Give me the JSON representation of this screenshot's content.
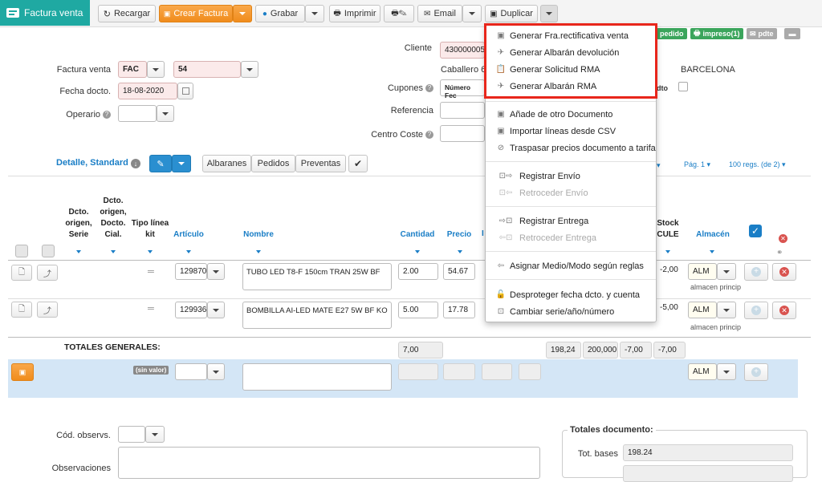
{
  "app": {
    "title": "Factura venta"
  },
  "toolbar": {
    "reload": "Recargar",
    "create_invoice": "Crear Factura",
    "save": "Grabar",
    "print": "Imprimir",
    "email": "Email",
    "duplicate": "Duplicar"
  },
  "badges": {
    "pedido": "pedido",
    "impreso": "impreso(1)",
    "pdte": "pdte"
  },
  "form": {
    "factura_label": "Factura venta",
    "serie": "FAC",
    "numero": "54",
    "fecha_label": "Fecha docto.",
    "fecha": "18-08-2020",
    "operario_label": "Operario",
    "cliente_label": "Cliente",
    "cliente_code": "430000005",
    "cliente_name": "Caballero 67",
    "ciudad": "BARCELONA",
    "cupones_label": "Cupones",
    "cupones_col1": "Número",
    "cupones_col2": "Fec",
    "dto_label": "dto",
    "referencia_label": "Referencia",
    "centro_coste_label": "Centro Coste"
  },
  "menu": {
    "items": [
      {
        "label": "Generar Fra.rectificativa venta",
        "icon": "doc-star-icon",
        "disabled": false
      },
      {
        "label": "Generar Albarán devolución",
        "icon": "plane-icon",
        "disabled": false
      },
      {
        "label": "Generar Solicitud RMA",
        "icon": "clipboard-icon",
        "disabled": false
      },
      {
        "label": "Generar Albarán RMA",
        "icon": "plane-icon",
        "disabled": false
      },
      {
        "label": "Añade de otro Documento",
        "icon": "doc-star-icon",
        "disabled": false
      },
      {
        "label": "Importar líneas desde CSV",
        "icon": "doc-star-icon",
        "disabled": false
      },
      {
        "label": "Traspasar precios documento a tarifa",
        "icon": "tag-icon",
        "disabled": false
      },
      {
        "label": "Registrar Envío",
        "icon": "box-arrow-icon",
        "disabled": false
      },
      {
        "label": "Retroceder Envío",
        "icon": "box-arrow-icon",
        "disabled": true
      },
      {
        "label": "Registrar Entrega",
        "icon": "truck-arrow-icon",
        "disabled": false
      },
      {
        "label": "Retroceder Entrega",
        "icon": "truck-arrow-icon",
        "disabled": true
      },
      {
        "label": "Asignar Medio/Modo según reglas",
        "icon": "arrow-left-icon",
        "disabled": false
      },
      {
        "label": "Desproteger fecha dcto. y cuenta",
        "icon": "lock-icon",
        "disabled": false
      },
      {
        "label": "Cambiar serie/año/número",
        "icon": "box-icon",
        "disabled": false
      }
    ]
  },
  "detail": {
    "view_label": "Detalle, Standard",
    "tabs": [
      "Albaranes",
      "Pedidos",
      "Preventas"
    ],
    "page": "Pág. 1",
    "regs": "100 regs. (de 2)"
  },
  "table": {
    "headers": {
      "dcto_origen_serie": "Dcto. origen, Serie",
      "dcto_origen_cial": "Dcto. origen, Docto. Cial.",
      "tipo_linea_kit": "Tipo línea kit",
      "articulo": "Artículo",
      "nombre": "Nombre",
      "cantidad": "Cantidad",
      "precio": "Precio",
      "stock_cule": "Stock CULE",
      "almacen": "Almacén"
    },
    "rows": [
      {
        "kit": "═",
        "articulo": "129870",
        "nombre": "TUBO LED T8-F 150cm TRAN 25W BF",
        "cantidad": "2.00",
        "precio": "54.67",
        "stock": "-2,00",
        "almacen": "ALM",
        "almacen_desc": "almacen princip"
      },
      {
        "kit": "═",
        "articulo": "129936",
        "nombre": "BOMBILLA AI-LED MATE E27 5W BF KO",
        "cantidad": "5.00",
        "precio": "17.78",
        "stock": "-5,00",
        "almacen": "ALM",
        "almacen_desc": "almacen princip"
      }
    ],
    "totals_label": "TOTALES GENERALES:",
    "totals": {
      "cantidad": "7,00",
      "t1": "198,24",
      "t2": "200,000",
      "t3": "-7,00",
      "t4": "-7,00"
    },
    "new_row": {
      "sin_valor": "(sin valor)",
      "almacen": "ALM"
    }
  },
  "footer": {
    "cod_observs_label": "Cód. observs.",
    "observaciones_label": "Observaciones",
    "totales_title": "Totales documento:",
    "tot_bases_label": "Tot. bases",
    "tot_bases": "198.24"
  }
}
